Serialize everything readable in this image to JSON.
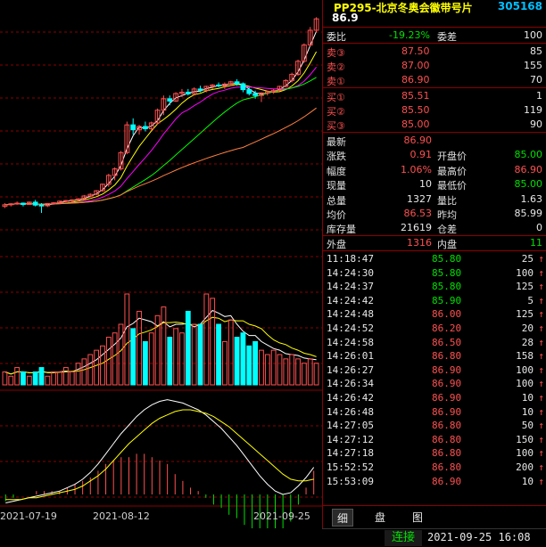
{
  "header": {
    "title": "PP295-北京冬奥会徽带号片",
    "code": "305168",
    "price": "86.9"
  },
  "quote": {
    "weibi_label": "委比",
    "weibi_value": "-19.23%",
    "weicha_label": "委差",
    "weicha_value": "100",
    "sell": [
      {
        "label": "卖③",
        "price": "87.50",
        "vol": "85"
      },
      {
        "label": "卖②",
        "price": "87.00",
        "vol": "155"
      },
      {
        "label": "卖①",
        "price": "86.90",
        "vol": "70"
      }
    ],
    "buy": [
      {
        "label": "买①",
        "price": "85.51",
        "vol": "1"
      },
      {
        "label": "买②",
        "price": "85.50",
        "vol": "119"
      },
      {
        "label": "买③",
        "price": "85.00",
        "vol": "90"
      }
    ],
    "stats": [
      {
        "l1": "最新",
        "v1": "86.90",
        "c1": "red",
        "l2": "",
        "v2": "",
        "c2": ""
      },
      {
        "l1": "涨跌",
        "v1": "0.91",
        "c1": "red",
        "l2": "开盘价",
        "v2": "85.00",
        "c2": "green"
      },
      {
        "l1": "幅度",
        "v1": "1.06%",
        "c1": "red",
        "l2": "最高价",
        "v2": "86.90",
        "c2": "red"
      },
      {
        "l1": "现量",
        "v1": "10",
        "c1": "white",
        "l2": "最低价",
        "v2": "85.00",
        "c2": "green"
      },
      {
        "l1": "总量",
        "v1": "1327",
        "c1": "white",
        "l2": "量比",
        "v2": "1.63",
        "c2": "white"
      },
      {
        "l1": "均价",
        "v1": "86.53",
        "c1": "red",
        "l2": "昨均",
        "v2": "85.99",
        "c2": "white"
      },
      {
        "l1": "库存量",
        "v1": "21619",
        "c1": "white",
        "l2": "仓差",
        "v2": "0",
        "c2": "white"
      }
    ],
    "outer_label": "外盘",
    "outer_value": "1316",
    "inner_label": "内盘",
    "inner_value": "11"
  },
  "ticks": [
    {
      "time": "11:18:47",
      "price": "85.80",
      "pc": "green",
      "vol": "25",
      "arrow": "↑"
    },
    {
      "time": "14:24:30",
      "price": "85.80",
      "pc": "green",
      "vol": "100",
      "arrow": "↑"
    },
    {
      "time": "14:24:37",
      "price": "85.80",
      "pc": "green",
      "vol": "125",
      "arrow": "↑"
    },
    {
      "time": "14:24:42",
      "price": "85.90",
      "pc": "green",
      "vol": "5",
      "arrow": "↑"
    },
    {
      "time": "14:24:48",
      "price": "86.00",
      "pc": "red",
      "vol": "125",
      "arrow": "↑"
    },
    {
      "time": "14:24:52",
      "price": "86.20",
      "pc": "red",
      "vol": "20",
      "arrow": "↑"
    },
    {
      "time": "14:24:58",
      "price": "86.50",
      "pc": "red",
      "vol": "28",
      "arrow": "↑"
    },
    {
      "time": "14:26:01",
      "price": "86.80",
      "pc": "red",
      "vol": "158",
      "arrow": "↑"
    },
    {
      "time": "14:26:27",
      "price": "86.90",
      "pc": "red",
      "vol": "100",
      "arrow": "↑"
    },
    {
      "time": "14:26:34",
      "price": "86.90",
      "pc": "red",
      "vol": "100",
      "arrow": "↑"
    },
    {
      "time": "14:26:42",
      "price": "86.90",
      "pc": "red",
      "vol": "10",
      "arrow": "↑"
    },
    {
      "time": "14:26:48",
      "price": "86.90",
      "pc": "red",
      "vol": "10",
      "arrow": "↑"
    },
    {
      "time": "14:27:05",
      "price": "86.80",
      "pc": "red",
      "vol": "50",
      "arrow": "↑"
    },
    {
      "time": "14:27:12",
      "price": "86.80",
      "pc": "red",
      "vol": "150",
      "arrow": "↑"
    },
    {
      "time": "14:27:18",
      "price": "86.80",
      "pc": "red",
      "vol": "100",
      "arrow": "↑"
    },
    {
      "time": "15:52:52",
      "price": "86.80",
      "pc": "red",
      "vol": "200",
      "arrow": "↑"
    },
    {
      "time": "15:53:09",
      "price": "86.90",
      "pc": "red",
      "vol": "10",
      "arrow": "↑"
    }
  ],
  "tabs": [
    "细",
    "盘",
    "图"
  ],
  "status": {
    "connect": "连接",
    "datetime": "2021-09-25 16:08"
  },
  "xaxis": [
    "2021-07-19",
    "2021-08-12",
    "2021-09-25"
  ],
  "colors": {
    "up": "#ff5050",
    "down": "#00e000",
    "cyan": "#00ffff",
    "grid": "#8b0000"
  },
  "chart_data": {
    "type": "candlestick",
    "candles": [
      [
        40,
        41,
        39.5,
        40.5
      ],
      [
        40.5,
        41,
        40,
        40.8
      ],
      [
        40.8,
        41.5,
        40.5,
        41
      ],
      [
        41,
        41.2,
        40,
        40.6
      ],
      [
        40.6,
        41.5,
        40.5,
        41.3
      ],
      [
        41.3,
        42,
        40,
        40.4
      ],
      [
        40.4,
        41,
        38,
        40.2
      ],
      [
        40.2,
        41,
        39.8,
        40.9
      ],
      [
        40.9,
        41.3,
        40.5,
        41.1
      ],
      [
        41.1,
        41.8,
        40.8,
        41.6
      ],
      [
        41.6,
        42,
        41.2,
        41.8
      ],
      [
        41.8,
        42.2,
        41.4,
        42
      ],
      [
        42,
        42.5,
        41.6,
        42.3
      ],
      [
        42.3,
        43.5,
        42,
        43.2
      ],
      [
        43.2,
        44,
        42.8,
        43.7
      ],
      [
        43.7,
        45,
        43.4,
        44.8
      ],
      [
        44.8,
        47,
        44.5,
        46.8
      ],
      [
        46.8,
        50,
        46,
        49.5
      ],
      [
        49.5,
        52,
        48,
        51.5
      ],
      [
        51.5,
        57,
        51,
        56.5
      ],
      [
        56.5,
        66,
        56,
        65
      ],
      [
        65,
        67,
        62,
        63.5
      ],
      [
        63.5,
        65,
        62,
        64.5
      ],
      [
        64.5,
        66,
        63,
        63.8
      ],
      [
        63.8,
        66,
        63.5,
        65.6
      ],
      [
        65.6,
        70,
        65,
        69.5
      ],
      [
        69.5,
        74,
        68,
        73
      ],
      [
        73,
        74,
        71,
        72.3
      ],
      [
        72.3,
        75,
        72,
        74.6
      ],
      [
        74.6,
        76,
        73.5,
        75
      ],
      [
        75,
        76,
        74,
        74.5
      ],
      [
        74.5,
        76.5,
        74,
        76
      ],
      [
        76,
        77,
        75,
        75.6
      ],
      [
        75.6,
        77,
        75,
        76.8
      ],
      [
        76.8,
        77.5,
        76,
        77.2
      ],
      [
        77.2,
        78,
        76.5,
        77
      ],
      [
        77,
        78,
        76,
        77.5
      ],
      [
        77.5,
        78.5,
        77,
        78.2
      ],
      [
        78.2,
        79,
        77,
        77.6
      ],
      [
        77.6,
        78,
        75,
        75.8
      ],
      [
        75.8,
        76.5,
        74,
        74.6
      ],
      [
        74.6,
        75.5,
        73,
        74
      ],
      [
        74,
        75,
        72,
        74.8
      ],
      [
        74.8,
        75.5,
        74,
        75.2
      ],
      [
        75.2,
        76,
        74.5,
        75.6
      ],
      [
        75.6,
        77,
        75.3,
        76.8
      ],
      [
        76.8,
        79,
        76.5,
        78.6
      ],
      [
        78.6,
        81,
        78,
        80.5
      ],
      [
        80.5,
        85,
        80,
        84.5
      ],
      [
        84.5,
        90,
        84,
        89.5
      ],
      [
        89.5,
        95,
        89,
        94
      ],
      [
        94,
        98,
        93.5,
        97.5
      ]
    ],
    "volume": [
      3,
      2,
      4,
      3,
      2,
      3,
      4,
      2,
      3,
      3,
      4,
      3,
      5,
      6,
      7,
      8,
      9,
      11,
      12,
      14,
      21,
      13,
      17,
      10,
      12,
      16,
      18,
      11,
      13,
      12,
      17,
      14,
      14,
      21,
      20,
      14,
      10,
      15,
      11,
      12,
      9,
      10,
      8,
      7,
      8,
      7,
      6,
      7,
      6,
      5,
      6,
      5
    ],
    "macd_dif": [
      -0.5,
      -0.4,
      -0.3,
      -0.2,
      -0.1,
      0,
      0.1,
      0.2,
      0.4,
      0.6,
      0.9,
      1.3,
      1.8,
      2.4,
      3,
      3.6,
      4.1,
      4.6,
      5,
      5.3,
      5.5,
      5.6,
      5.5,
      5.4,
      5.2,
      5,
      4.7,
      4.3,
      3.9,
      3.4,
      2.9,
      2.3,
      1.7,
      1.1,
      0.6,
      0.2,
      0,
      0.1,
      0.5,
      1.0,
      1.6
    ],
    "macd_dea": [
      -0.3,
      -0.3,
      -0.3,
      -0.2,
      -0.2,
      -0.1,
      0,
      0.1,
      0.2,
      0.3,
      0.5,
      0.8,
      1.1,
      1.5,
      2,
      2.5,
      3,
      3.4,
      3.8,
      4.2,
      4.5,
      4.7,
      4.9,
      5,
      5,
      4.9,
      4.8,
      4.6,
      4.3,
      4,
      3.6,
      3.2,
      2.8,
      2.4,
      2,
      1.6,
      1.2,
      0.9,
      0.8,
      0.8,
      0.9
    ]
  }
}
